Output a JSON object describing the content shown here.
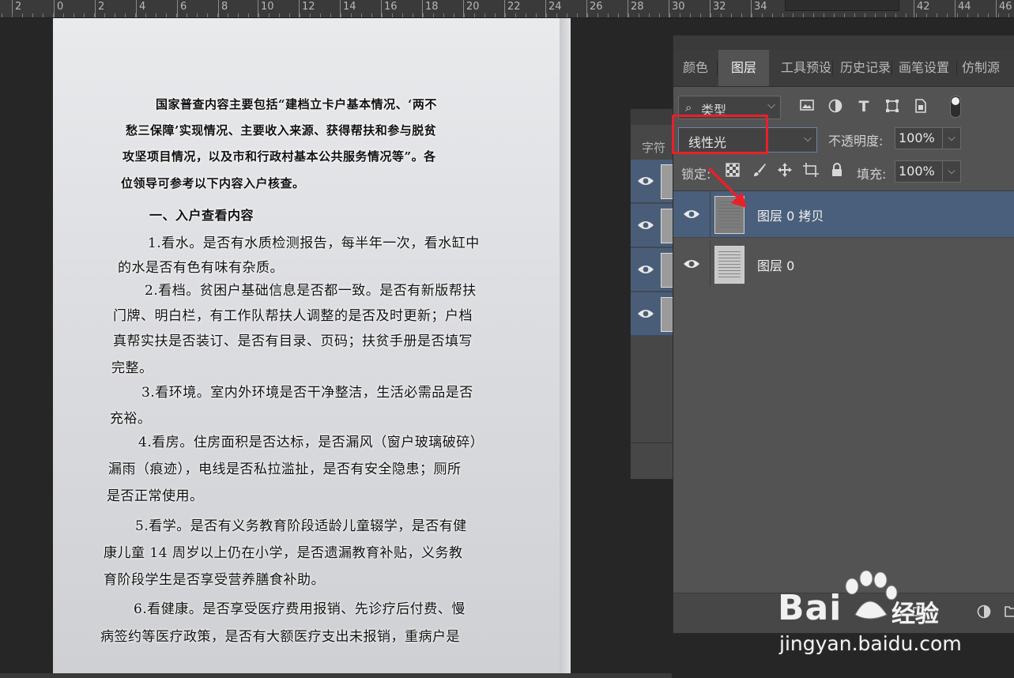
{
  "ruler": {
    "labels": [
      "2",
      "0",
      "2",
      "4",
      "6",
      "8",
      "10",
      "12",
      "14",
      "16",
      "18",
      "20",
      "22",
      "24",
      "26",
      "28",
      "30",
      "32",
      "34",
      "42",
      "44",
      "46"
    ]
  },
  "document": {
    "lines": [
      "国家普查内容主要包括“建档立卡户基本情况、‘两不",
      "愁三保障’实现情况、主要收入来源、获得帮扶和参与脱贫",
      "攻坚项目情况，以及市和行政村基本公共服务情况等”。各",
      "位领导可参考以下内容入户核查。",
      "一、入户查看内容",
      "1.看水。是否有水质检测报告，每半年一次，看水缸中",
      "的水是否有色有味有杂质。",
      "2.看档。贫困户基础信息是否都一致。是否有新版帮扶",
      "门牌、明白栏，有工作队帮扶人调整的是否及时更新；户档",
      "真帮实扶是否装订、是否有目录、页码；扶贫手册是否填写",
      "完整。",
      "3.看环境。室内外环境是否干净整洁，生活必需品是否",
      "充裕。",
      "4.看房。住房面积是否达标，是否漏风（窗户玻璃破碎）",
      "漏雨（痕迹），电线是否私拉滥扯，是否有安全隐患；厕所",
      "是否正常使用。",
      "5.看学。是否有义务教育阶段适龄儿童辍学，是否有健",
      "康儿童 14 周岁以上仍在小学，是否遗漏教育补贴，义务教",
      "育阶段学生是否享受营养膳食补助。",
      "6.看健康。是否享受医疗费用报销、先诊疗后付费、慢",
      "病签约等医疗政策，是否有大额医疗支出未报销，重病户是"
    ]
  },
  "char_panel": {
    "tab_label": "字符"
  },
  "layers_panel": {
    "tabs": [
      "颜色",
      "图层",
      "工具预设",
      "历史记录",
      "画笔设置",
      "仿制源"
    ],
    "active_tab": "图层",
    "filter": {
      "label": "类型",
      "search_icon": "search-icon"
    },
    "filter_icons": [
      "image-filter-icon",
      "adjustment-filter-icon",
      "type-filter-icon",
      "shape-filter-icon",
      "smart-object-filter-icon"
    ],
    "blend_mode": "线性光",
    "opacity_label": "不透明度:",
    "opacity_value": "100%",
    "lock_label": "锁定:",
    "lock_icons": [
      "lock-transparent-icon",
      "lock-brush-icon",
      "lock-move-icon",
      "lock-artboard-icon",
      "lock-all-icon"
    ],
    "fill_label": "填充:",
    "fill_value": "100%",
    "layers": [
      {
        "name": "图层 0 拷贝",
        "selected": true,
        "visible": true
      },
      {
        "name": "图层 0",
        "selected": false,
        "visible": true
      }
    ],
    "highlight_color": "#e8202a",
    "selection_color": "#4a5f7b"
  },
  "watermark": {
    "brand": "Bai",
    "brand_suffix": "经验",
    "url": "jingyan.baidu.com"
  }
}
